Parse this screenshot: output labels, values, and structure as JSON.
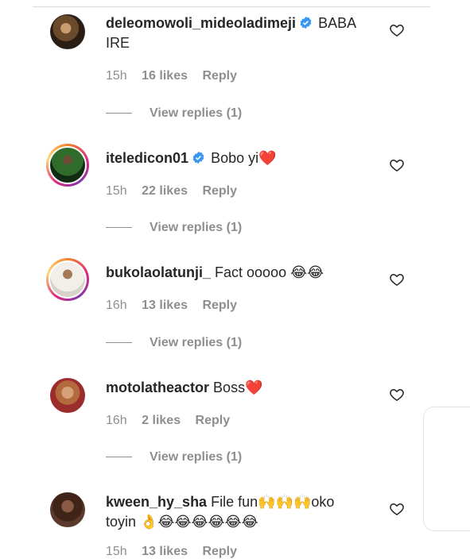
{
  "comments": [
    {
      "username": "deleomowoli_mideoladimeji",
      "verified": true,
      "text": "BABA IRE",
      "time": "15h",
      "likes": "16 likes",
      "reply": "Reply",
      "view_replies": "View replies (1)"
    },
    {
      "username": "iteledicon01",
      "verified": true,
      "text": "Bobo yi❤️",
      "time": "15h",
      "likes": "22 likes",
      "reply": "Reply",
      "view_replies": "View replies (1)"
    },
    {
      "username": "bukolaolatunji_",
      "verified": false,
      "text": "Fact ooooo 😂😂",
      "time": "16h",
      "likes": "13 likes",
      "reply": "Reply",
      "view_replies": "View replies (1)"
    },
    {
      "username": "motolatheactor",
      "verified": false,
      "text": "Boss❤️",
      "time": "16h",
      "likes": "2 likes",
      "reply": "Reply",
      "view_replies": "View replies (1)"
    },
    {
      "username": "kween_hy_sha",
      "verified": false,
      "text": "File fun🙌🙌🙌oko toyin 👌😂😂😂😂😂😂",
      "time": "15h",
      "likes": "13 likes",
      "reply": "Reply"
    }
  ],
  "icons": {
    "like": "heart-outline-icon",
    "verified": "verified-badge-icon"
  },
  "colors": {
    "verified": "#3897f0",
    "meta_text": "#8e8e8e",
    "story_ring": "#dd2a7b"
  }
}
